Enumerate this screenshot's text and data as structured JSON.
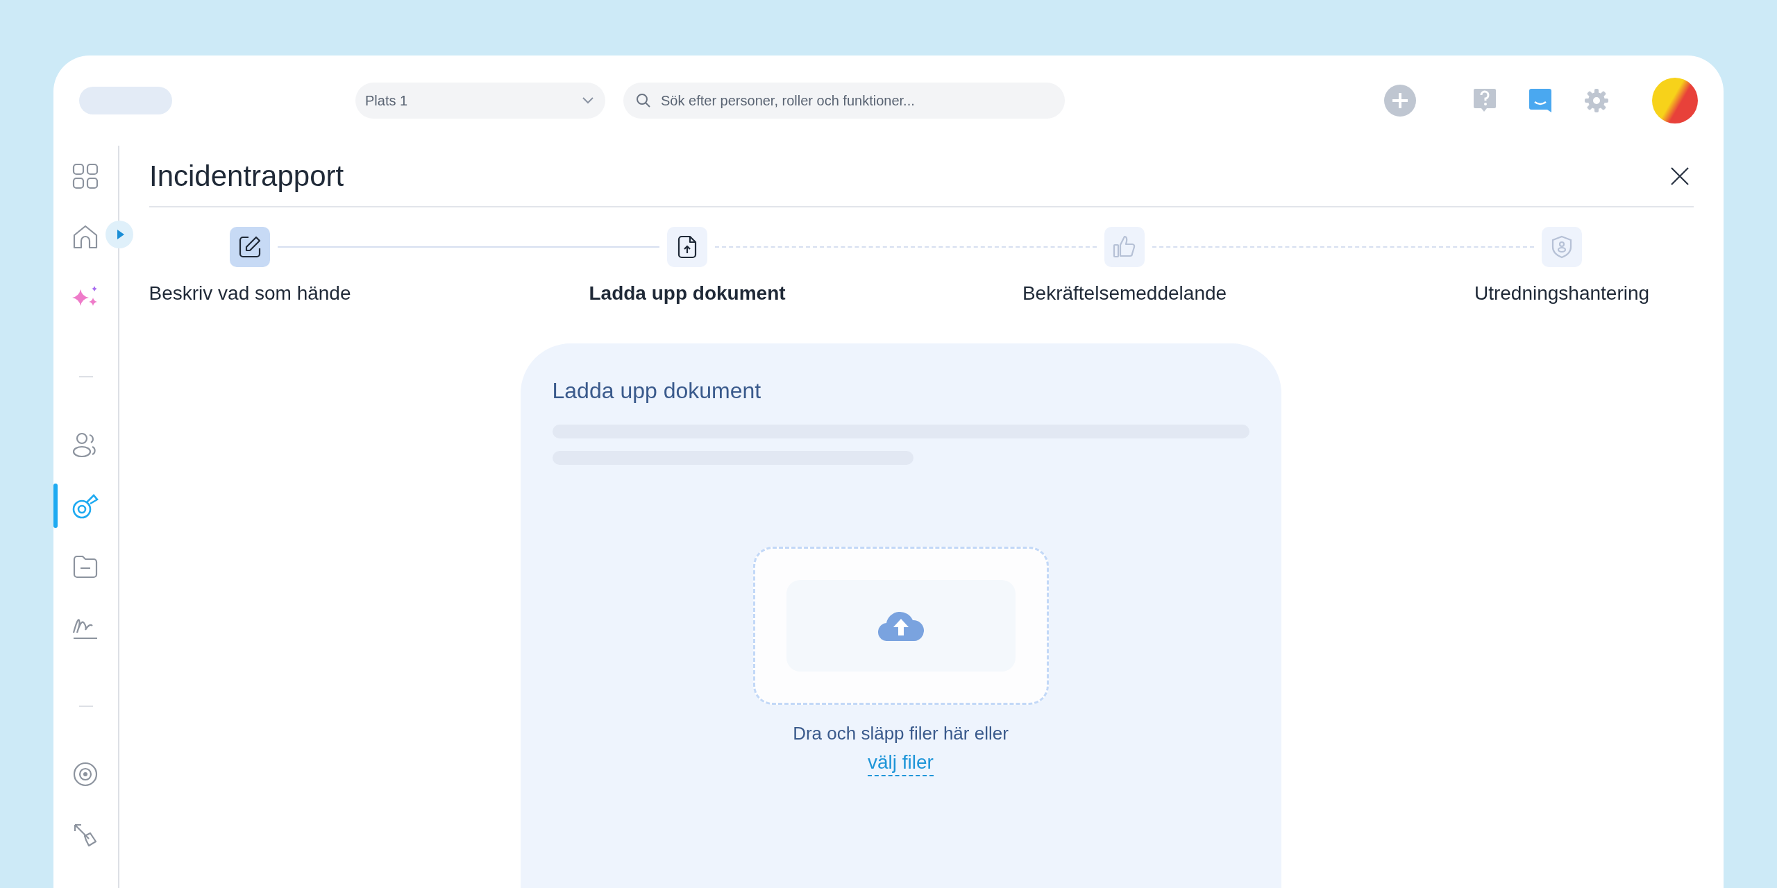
{
  "topbar": {
    "location_select": {
      "value": "Plats 1"
    },
    "search": {
      "placeholder": "Sök efter personer, roller och funktioner..."
    }
  },
  "sidebar": {
    "items": [
      {
        "selected": false
      },
      {
        "selected": false
      },
      {
        "selected": false
      },
      {
        "selected": false
      },
      {
        "selected": true
      },
      {
        "selected": false
      },
      {
        "selected": false
      },
      {
        "selected": false
      },
      {
        "selected": false
      }
    ]
  },
  "page": {
    "title": "Incidentrapport"
  },
  "steps": [
    {
      "label": "Beskriv vad som hände",
      "completed": true,
      "selected": false
    },
    {
      "label": "Ladda upp dokument",
      "completed": false,
      "selected": true
    },
    {
      "label": "Bekräftelsemeddelande",
      "completed": false,
      "selected": false
    },
    {
      "label": "Utredningshantering",
      "completed": false,
      "selected": false
    }
  ],
  "upload_card": {
    "title": "Ladda upp dokument",
    "drop_text": "Dra och släpp filer här eller",
    "browse_link": "välj filer"
  }
}
